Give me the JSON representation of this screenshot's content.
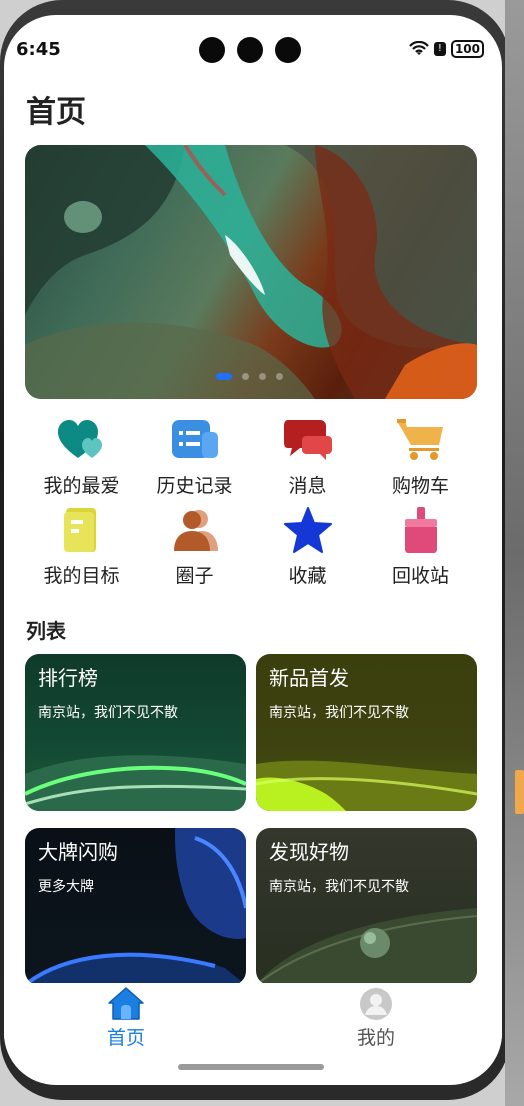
{
  "status_bar": {
    "time": "6:45",
    "battery": "100"
  },
  "page": {
    "title": "首页"
  },
  "banner": {
    "page_count": 4,
    "active_index": 0
  },
  "quick_menu": [
    {
      "label": "我的最爱",
      "icon": "hearts-icon",
      "color": "#0e8a85"
    },
    {
      "label": "历史记录",
      "icon": "history-list-icon",
      "color": "#3b8fe3"
    },
    {
      "label": "消息",
      "icon": "message-bubbles-icon",
      "color": "#c92b2b"
    },
    {
      "label": "购物车",
      "icon": "shopping-cart-icon",
      "color": "#f0b34a"
    },
    {
      "label": "我的目标",
      "icon": "goal-document-icon",
      "color": "#d9d63a"
    },
    {
      "label": "圈子",
      "icon": "people-icon",
      "color": "#b25a2a"
    },
    {
      "label": "收藏",
      "icon": "star-icon",
      "color": "#1537d6"
    },
    {
      "label": "回收站",
      "icon": "broom-icon",
      "color": "#e04a7a"
    }
  ],
  "list_section": {
    "title": "列表"
  },
  "cards": [
    {
      "title": "排行榜",
      "subtitle": "南京站，我们不见不散"
    },
    {
      "title": "新品首发",
      "subtitle": "南京站，我们不见不散"
    },
    {
      "title": "大牌闪购",
      "subtitle": "更多大牌"
    },
    {
      "title": "发现好物",
      "subtitle": "南京站，我们不见不散"
    }
  ],
  "tab_bar": {
    "home_label": "首页",
    "mine_label": "我的",
    "active_color": "#1a7fe0",
    "inactive_color": "#555555"
  }
}
